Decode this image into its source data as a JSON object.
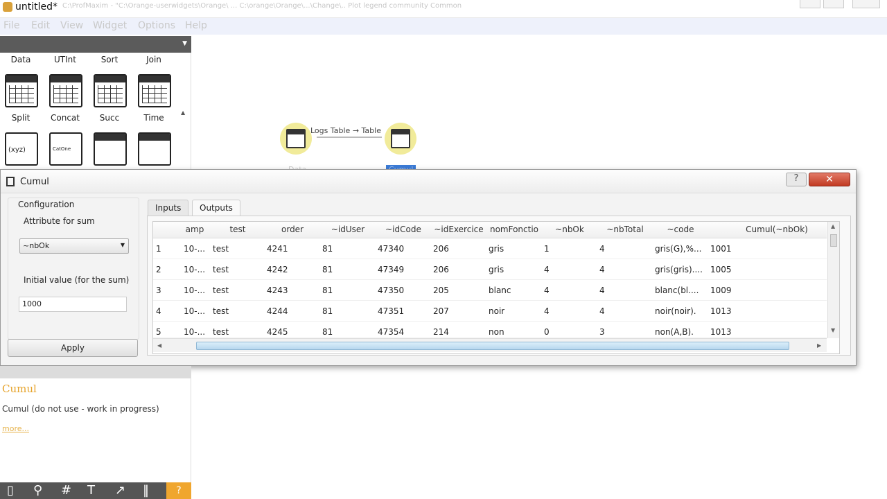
{
  "window": {
    "title": "untitled*",
    "path": "C:\\ProfMaxim - \"C:\\Orange-userwidgets\\Orange\\ ... C:\\orange\\Orange\\...\\Change\\..  Plot legend   community  Common"
  },
  "menu": [
    "File",
    "Edit",
    "View",
    "Widget",
    "Options",
    "Help"
  ],
  "toolbox": {
    "row1": [
      "Data",
      "UTInt",
      "Sort",
      "Join"
    ],
    "row2": [
      "Split",
      "Concat",
      "Succ",
      "Time"
    ],
    "icon_texts": {
      "xyz": "(xyz)",
      "catone": "CatOne"
    }
  },
  "canvas": {
    "link_label": "Logs Table → Table",
    "node1_label": "Data",
    "node2_label": "Cumul"
  },
  "dialog": {
    "title": "Cumul",
    "help": "?",
    "close": "✕",
    "config_title": "Configuration",
    "attr_label": "Attribute for sum",
    "attr_value": "~nbOk",
    "init_label": "Initial value (for the sum)",
    "init_value": "1000",
    "apply": "Apply",
    "tabs": [
      "Inputs",
      "Outputs"
    ]
  },
  "table": {
    "headers": [
      "amp",
      "test",
      "order",
      "~idUser",
      "~idCode",
      "~idExercice",
      "nomFonctio",
      "~nbOk",
      "~nbTotal",
      "~code",
      "Cumul(~nbOk)"
    ],
    "rows": [
      {
        "n": "1",
        "c": [
          "10-...",
          "test",
          "4241",
          "81",
          "47340",
          "206",
          "gris",
          "1",
          "4",
          "gris(G),%...",
          "1001"
        ]
      },
      {
        "n": "2",
        "c": [
          "10-...",
          "test",
          "4242",
          "81",
          "47349",
          "206",
          "gris",
          "4",
          "4",
          "gris(gris)....",
          "1005"
        ]
      },
      {
        "n": "3",
        "c": [
          "10-...",
          "test",
          "4243",
          "81",
          "47350",
          "205",
          "blanc",
          "4",
          "4",
          "blanc(bl....",
          "1009"
        ]
      },
      {
        "n": "4",
        "c": [
          "10-...",
          "test",
          "4244",
          "81",
          "47351",
          "207",
          "noir",
          "4",
          "4",
          "noir(noir).",
          "1013"
        ]
      },
      {
        "n": "5",
        "c": [
          "10-...",
          "test",
          "4245",
          "81",
          "47354",
          "214",
          "non",
          "0",
          "3",
          "non(A,B).",
          "1013"
        ]
      }
    ]
  },
  "description": {
    "title": "Cumul",
    "text": "Cumul (do not use - work in progress)",
    "more": "more..."
  },
  "colors": {
    "accent": "#f0a62e",
    "node": "#f1eb9a",
    "close": "#c13a22",
    "selection": "#3b7bd6"
  }
}
